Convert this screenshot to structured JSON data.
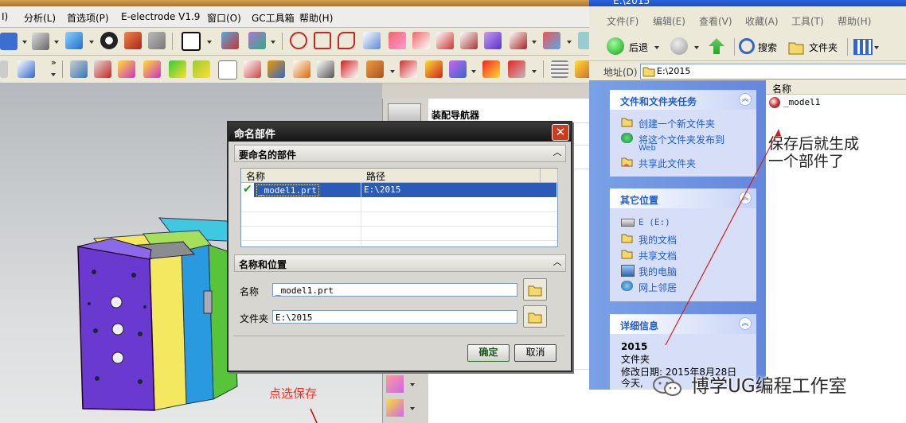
{
  "nx": {
    "menu": [
      "I)",
      "分析(L)",
      "首选项(P)",
      "E-electrode V1.9",
      "窗口(O)",
      "GC工具箱",
      "帮助(H)"
    ],
    "nav_title": "装配导航器",
    "viewport_note": "点选保存"
  },
  "dialog": {
    "title": "命名部件",
    "section1": "要命名的部件",
    "col_name": "名称",
    "col_path": "路径",
    "row_name": "_model1.prt",
    "row_path": "E:\\2015",
    "section2": "名称和位置",
    "name_label": "名称",
    "name_value": "_model1.prt",
    "folder_label": "文件夹",
    "folder_value": "E:\\2015",
    "ok": "确定",
    "cancel": "取消",
    "close_glyph": "✕",
    "collapse_glyph": "︿"
  },
  "explorer": {
    "title": "E:\\2015",
    "menu": [
      "文件(F)",
      "编辑(E)",
      "查看(V)",
      "收藏(A)",
      "工具(T)",
      "帮助(H)"
    ],
    "back": "后退",
    "search": "搜索",
    "folders": "文件夹",
    "address_label": "地址(D)",
    "address_value": "E:\\2015",
    "tasks": {
      "title": "文件和文件夹任务",
      "items": [
        "创建一个新文件夹",
        "将这个文件夹发布到",
        "Web",
        "共享此文件夹"
      ]
    },
    "places": {
      "title": "其它位置",
      "items": [
        "E (E:)",
        "我的文档",
        "共享文档",
        "我的电脑",
        "网上邻居"
      ]
    },
    "details": {
      "title": "详细信息",
      "name": "2015",
      "type": "文件夹",
      "modified": "修改日期: 2015年8月28日",
      "time": "今天,"
    },
    "col_name": "名称",
    "file": "_model1",
    "annotation_line1": "保存后就生成",
    "annotation_line2": "一个部件了"
  },
  "watermark": "博学UG编程工作室",
  "colors": {
    "selection": "#2b5bb9",
    "dialog_title": "#151515",
    "close": "#d03a1a",
    "red_note": "#e8352a",
    "xp_task_blue": "#215dc6"
  }
}
